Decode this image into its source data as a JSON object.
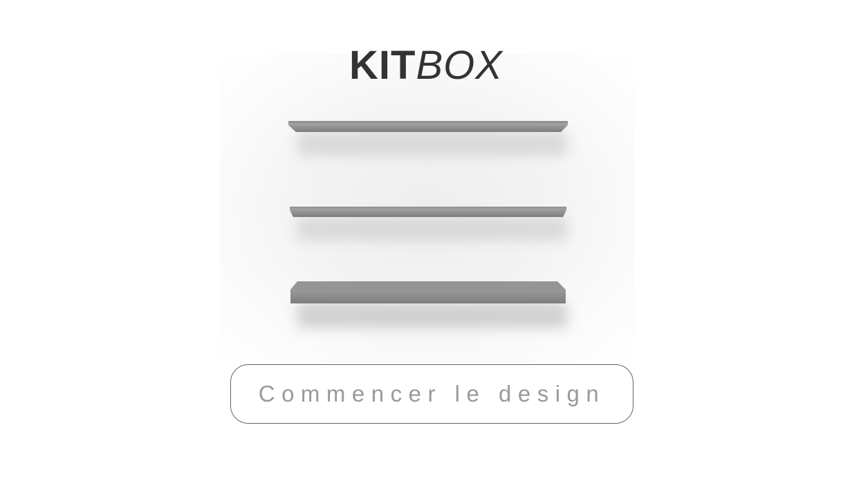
{
  "brand": {
    "kit": "KIT",
    "box": "BOX"
  },
  "hero": {
    "image": "wall-shelves-image",
    "shelf_color": "#8e8e8e",
    "shelf_top_color": "#a8a8a8"
  },
  "cta": {
    "label": "Commencer le design",
    "text_color": "#9a9a9a",
    "border_color": "#7a5a5a"
  }
}
